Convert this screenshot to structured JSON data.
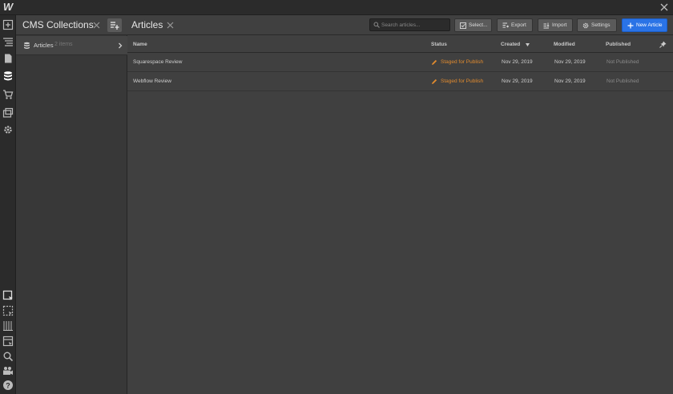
{
  "app": {
    "logo": "W"
  },
  "left_toolbar": {
    "icons": [
      "add-panel-icon",
      "navigator-icon",
      "pages-icon",
      "cms-icon",
      "ecommerce-icon",
      "assets-icon",
      "settings-icon",
      "select-tool-icon",
      "selection-box-icon",
      "grid-icon",
      "style-manager-icon",
      "search-icon",
      "video-icon",
      "help-icon"
    ]
  },
  "collections_panel": {
    "title": "CMS Collections",
    "items": [
      {
        "label": "Articles",
        "count": "2 items"
      }
    ]
  },
  "main": {
    "title": "Articles",
    "search": {
      "placeholder": "Search articles..."
    },
    "buttons": {
      "select": "Select...",
      "export": "Export",
      "import": "Import",
      "settings": "Settings",
      "new": "New Article"
    },
    "table": {
      "columns": [
        "Name",
        "Status",
        "Created",
        "Modified",
        "Published"
      ],
      "rows": [
        {
          "name": "Squarespace Review",
          "status": "Staged for Publish",
          "created": "Nov 29, 2019",
          "modified": "Nov 29, 2019",
          "published": "Not Published"
        },
        {
          "name": "Webflow Review",
          "status": "Staged for Publish",
          "created": "Nov 29, 2019",
          "modified": "Nov 29, 2019",
          "published": "Not Published"
        }
      ]
    }
  },
  "colors": {
    "accent_blue": "#2a73e6",
    "status_orange": "#e08a2e",
    "panel_bg": "#404040",
    "sidebar_bg": "#2b2b2b"
  }
}
